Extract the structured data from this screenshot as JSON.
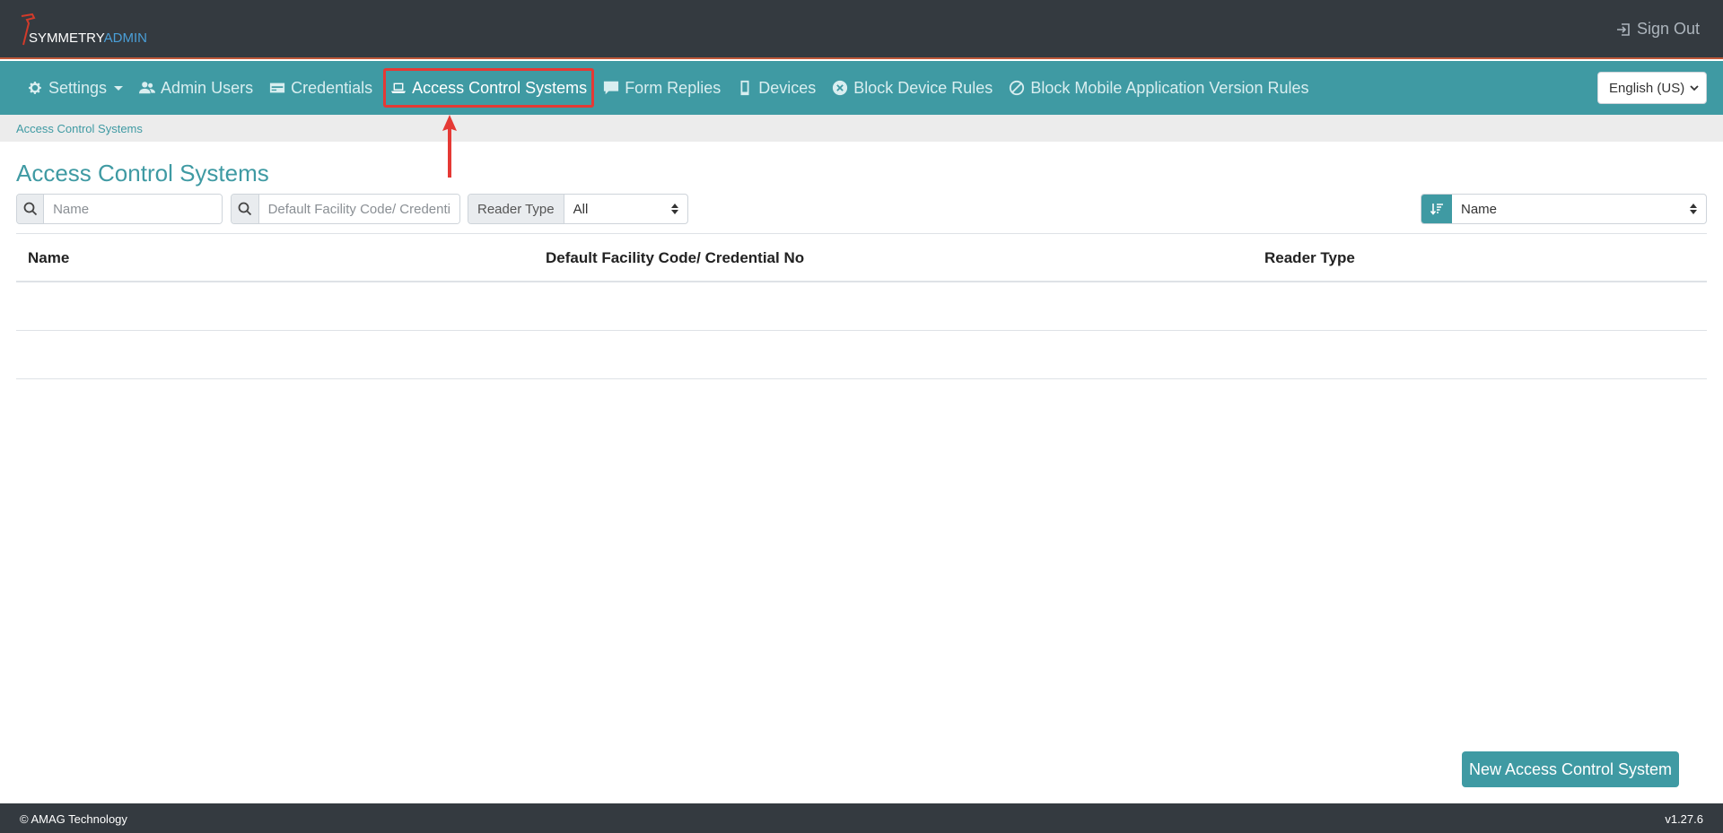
{
  "brand": {
    "name_part1": "SYMMETRY",
    "name_part2": "ADMIN"
  },
  "header": {
    "signout_label": "Sign Out"
  },
  "nav": {
    "items": [
      {
        "label": "Settings",
        "icon": "gear-icon"
      },
      {
        "label": "Admin Users",
        "icon": "users-icon"
      },
      {
        "label": "Credentials",
        "icon": "credential-card-icon"
      },
      {
        "label": "Access Control Systems",
        "icon": "laptop-icon",
        "active": true
      },
      {
        "label": "Form Replies",
        "icon": "comment-icon"
      },
      {
        "label": "Devices",
        "icon": "mobile-icon"
      },
      {
        "label": "Block Device Rules",
        "icon": "times-circle-icon"
      },
      {
        "label": "Block Mobile Application Version Rules",
        "icon": "ban-icon"
      }
    ],
    "language": "English (US)"
  },
  "breadcrumb": {
    "current": "Access Control Systems"
  },
  "page": {
    "title": "Access Control Systems",
    "filters": {
      "name_placeholder": "Name",
      "facility_placeholder": "Default Facility Code/ Credential No",
      "reader_type_label": "Reader Type",
      "reader_type_value": "All",
      "sort_value": "Name"
    },
    "table": {
      "columns": [
        "Name",
        "Default Facility Code/ Credential No",
        "Reader Type"
      ],
      "rows": []
    },
    "new_button": "New Access Control System"
  },
  "footer": {
    "copyright": "© AMAG Technology",
    "version": "v1.27.6"
  },
  "colors": {
    "accent": "#3f9aa3",
    "topbar": "#343a40",
    "highlight": "#e53935"
  }
}
